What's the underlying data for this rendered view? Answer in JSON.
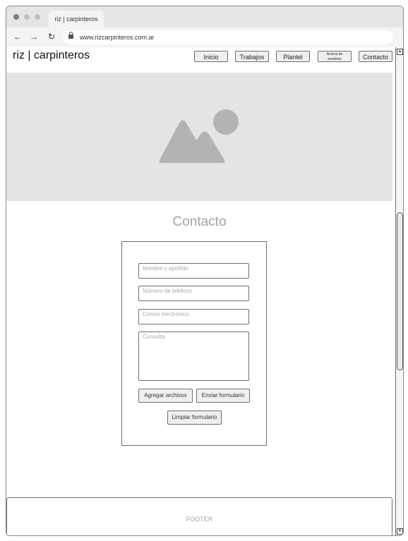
{
  "browser": {
    "tab_title": "riz | carpinteros",
    "url": "www.rizcarpinteros.com.ar",
    "back_icon": "←",
    "forward_icon": "→",
    "reload_icon": "↻"
  },
  "header": {
    "logo": "riz | carpinteros",
    "nav": {
      "inicio": "Inicio",
      "trabajos": "Trabajos",
      "plantel": "Plantel",
      "acerca_line1": "Acerca de",
      "acerca_line2": "nosotros",
      "contacto": "Contacto"
    }
  },
  "hero": {
    "icon": "image-placeholder-icon"
  },
  "contact": {
    "title": "Contacto",
    "fields": {
      "name": "Nombre y apellido",
      "phone": "Número de teléfono",
      "email": "Correo electrónico",
      "query": "Consulta"
    },
    "buttons": {
      "attach": "Agregar archivos",
      "send": "Enviar formulario",
      "clear": "Limpiar formulario"
    }
  },
  "footer": {
    "label": "FOOTER"
  },
  "scrollbar": {
    "up": "▲",
    "down": "▼"
  }
}
